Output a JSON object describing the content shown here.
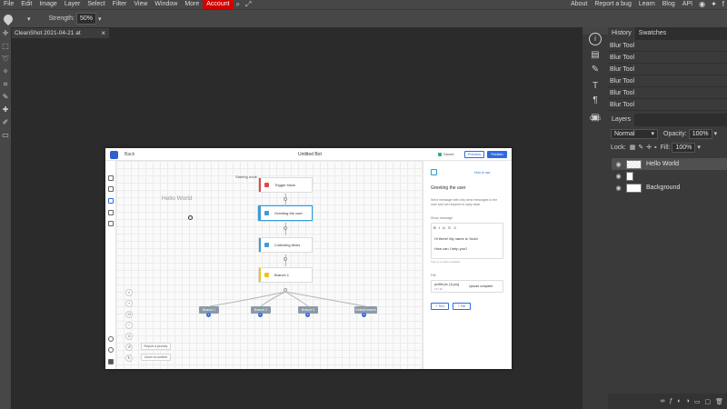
{
  "menu": {
    "items": [
      "File",
      "Edit",
      "Image",
      "Layer",
      "Select",
      "Filter",
      "View",
      "Window",
      "More"
    ],
    "account": "Account",
    "right_links": [
      "About",
      "Report a bug",
      "Learn",
      "Blog",
      "API"
    ]
  },
  "options": {
    "strength_label": "Strength:",
    "strength_value": "50%"
  },
  "document": {
    "tab_title": "CleanShot 2021-04-21 at",
    "close": "×"
  },
  "canvas": {
    "app": {
      "back": "Back",
      "title": "Untitled Bot",
      "saved": "Saved",
      "preview": "Preview",
      "publish": "Publish"
    },
    "hello": "Hello World",
    "start_label": "Starting node",
    "nodes": [
      "Trigger block",
      "Greeting the user",
      "Collecting items",
      "Branch 1"
    ],
    "outputs": [
      "Branch 1",
      "Branch 2",
      "Branch 3",
      "Default branch"
    ],
    "output_numbers": [
      "1",
      "2",
      "3",
      "4"
    ],
    "zoom": {
      "search": "⌕",
      "plus": "+",
      "fit": "⊡",
      "minus": "−",
      "lock": "⊙"
    },
    "buttons": {
      "report": "Report a journey",
      "zoom": "Zoom to content"
    },
    "panel": {
      "howto": "How to use",
      "title": "Greeting the user",
      "desc": "Send message with only send messages to the user and not required to reply back",
      "section": "Show message",
      "toolbar": "B I U S ☺",
      "line1": "Hi there! My name is Yoobi",
      "line2": "How can I help you?",
      "hint": "Type {{ to add a variable",
      "file_label": "File",
      "file_name": "profile pic (1).png",
      "file_size": "137 kb",
      "file_status": "Upload complete",
      "add_text": "+ Text",
      "add_file": "+ File"
    }
  },
  "strip": {
    "info": "i",
    "css": "CSS"
  },
  "history": {
    "tabs": [
      "History",
      "Swatches"
    ],
    "rows": [
      "Blur Tool",
      "Blur Tool",
      "Blur Tool",
      "Blur Tool",
      "Blur Tool",
      "Blur Tool"
    ]
  },
  "layers": {
    "tab": "Layers",
    "blend": "Normal",
    "opacity_label": "Opacity:",
    "opacity_value": "100%",
    "lock_label": "Lock:",
    "fill_label": "Fill:",
    "fill_value": "100%",
    "rows": [
      {
        "name": "Hello World"
      },
      {
        "name": ""
      },
      {
        "name": "Background"
      }
    ],
    "footer_icons": [
      "link-icon",
      "fx-icon",
      "mask-icon",
      "adjust-icon",
      "folder-icon",
      "new-layer-icon",
      "trash-icon"
    ]
  }
}
